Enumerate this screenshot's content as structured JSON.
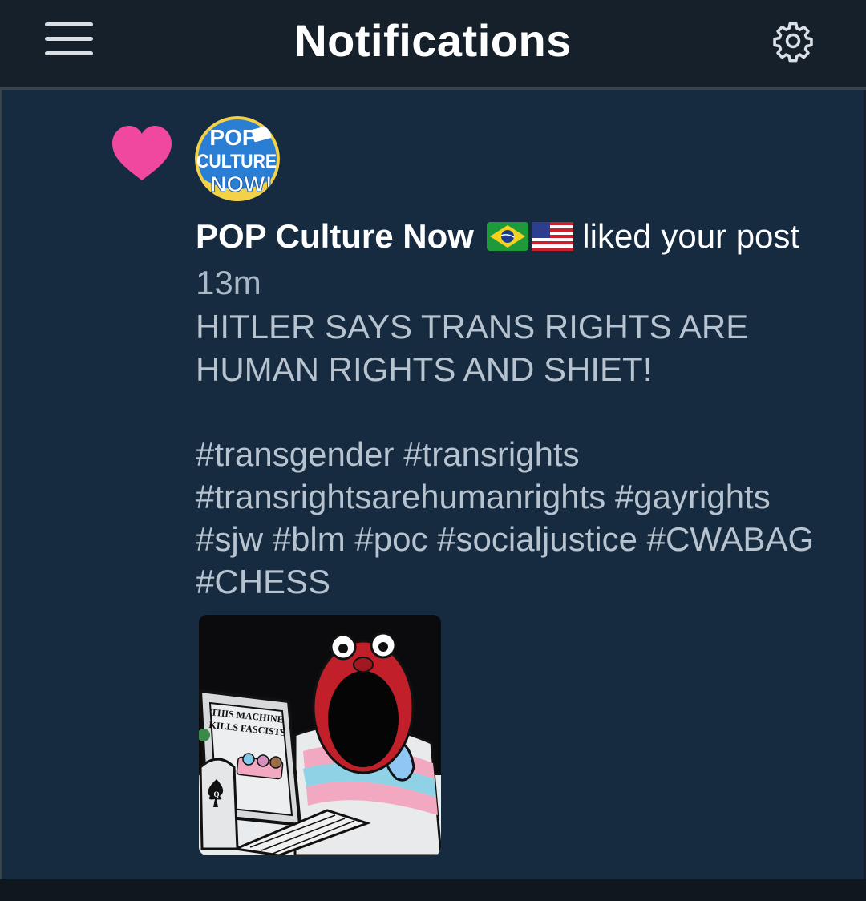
{
  "header": {
    "title": "Notifications",
    "menu_icon": "hamburger-menu-icon",
    "settings_icon": "gear-icon"
  },
  "notification": {
    "type_icon": "heart-icon",
    "avatar": {
      "line1": "POP",
      "line2": "CULTURE",
      "line3": "NOW!"
    },
    "account_name": "POP Culture Now",
    "flags": [
      "brazil-flag-icon",
      "usa-flag-icon"
    ],
    "action": "liked your post",
    "time": "13m",
    "post_text": "HITLER SAYS TRANS RIGHTS ARE HUMAN RIGHTS AND SHIET!",
    "hashtags": [
      "#transgender",
      "#transrights",
      "#transrightsarehumanrights",
      "#gayrights",
      "#sjw",
      "#blm",
      "#poc",
      "#socialjustice",
      "#CWABAG",
      "#CHESS"
    ],
    "media": {
      "sign_line1": "THIS MACHINE",
      "sign_line2": "KILLS FASCISTS",
      "card_letter": "Q"
    }
  },
  "colors": {
    "background": "#15202b",
    "card": "#162a40",
    "heart": "#f0489e",
    "text_primary": "#ffffff",
    "text_secondary": "#b7c3cf"
  }
}
